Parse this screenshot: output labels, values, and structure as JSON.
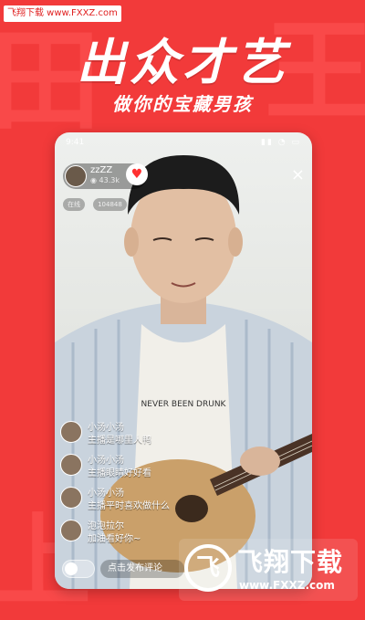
{
  "watermark_top": "飞翔下载 www.FXXZ.com",
  "headline": "出众才艺",
  "subline": "做你的宝藏男孩",
  "phone": {
    "status_time": "9:41",
    "status_icons": "▮▮ ◔ ▭",
    "streamer": {
      "name": "zzZZ",
      "fans": "43.3k"
    },
    "follow_icon": "heart-icon",
    "tags": [
      "在线",
      "104848"
    ],
    "close_icon": "×",
    "comments": [
      {
        "user": "小汤小汤",
        "text": "主播是哪里人鸭"
      },
      {
        "user": "小汤小汤",
        "text": "主播眼睛好好看"
      },
      {
        "user": "小汤小汤",
        "text": "主播平时喜欢做什么"
      },
      {
        "user": "泡泡拉尔",
        "text": "加油看好你~"
      }
    ],
    "comment_placeholder": "点击发布评论"
  },
  "watermark_logo": {
    "title": "飞翔下载",
    "url": "www.FXXZ.com"
  },
  "colors": {
    "background": "#f23a3a",
    "accent": "#ff3030"
  }
}
